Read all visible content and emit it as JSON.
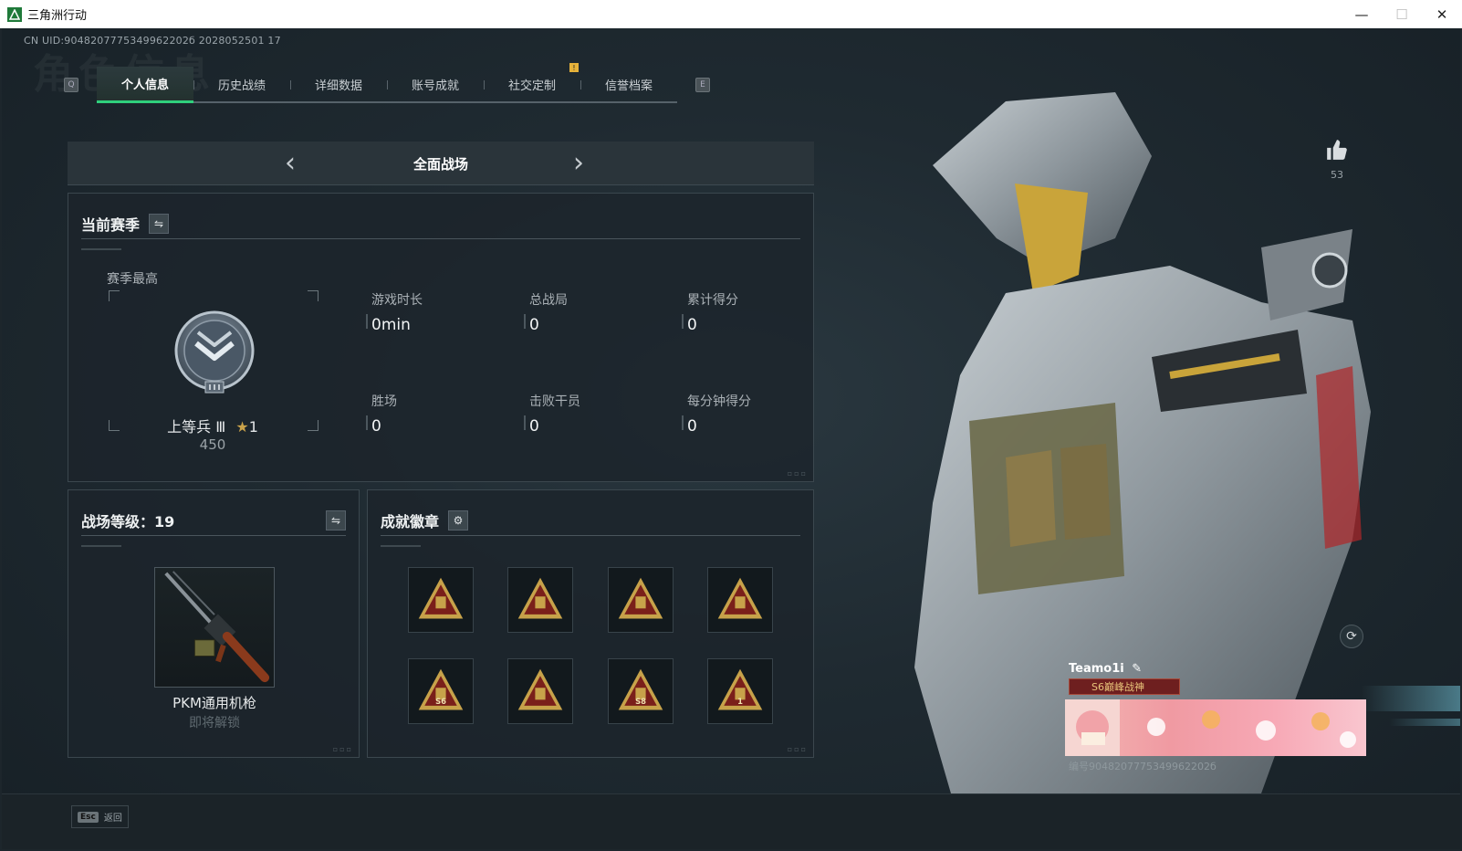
{
  "window": {
    "title": "三角洲行动",
    "minimize": "—",
    "maximize": "☐",
    "close": "✕"
  },
  "uid_line": "CN UID:9048207775349962202б 2028052501 17",
  "watermark": "角色信息",
  "tabs": {
    "left_key": "Q",
    "right_key": "E",
    "alert": "!",
    "items": [
      {
        "label": "个人信息",
        "active": true
      },
      {
        "label": "历史战绩",
        "active": false
      },
      {
        "label": "详细数据",
        "active": false
      },
      {
        "label": "账号成就",
        "active": false
      },
      {
        "label": "社交定制",
        "active": false
      },
      {
        "label": "信誉档案",
        "active": false
      }
    ]
  },
  "mode": {
    "title": "全面战场",
    "prev": "‹",
    "next": "›"
  },
  "season": {
    "heading": "当前赛季",
    "best_label": "赛季最高",
    "rank_name": "上等兵 Ⅲ",
    "rank_stars": "1",
    "rank_score": "450",
    "stats": [
      {
        "label": "游戏时长",
        "value": "0min"
      },
      {
        "label": "总战局",
        "value": "0"
      },
      {
        "label": "累计得分",
        "value": "0"
      },
      {
        "label": "胜场",
        "value": "0"
      },
      {
        "label": "击败干员",
        "value": "0"
      },
      {
        "label": "每分钟得分",
        "value": "0"
      }
    ]
  },
  "level": {
    "heading": "战场等级：19",
    "weapon_name": "PKM通用机枪",
    "weapon_status": "即将解锁"
  },
  "badges": {
    "heading": "成就徽章",
    "items": [
      {
        "icon": "badge-tank-icon",
        "text": ""
      },
      {
        "icon": "badge-helmet-icon",
        "text": ""
      },
      {
        "icon": "badge-rocket-icon",
        "text": ""
      },
      {
        "icon": "badge-eagle-icon",
        "text": ""
      },
      {
        "icon": "badge-s6-icon",
        "text": "S6"
      },
      {
        "icon": "badge-crate-icon",
        "text": ""
      },
      {
        "icon": "badge-s8-icon",
        "text": "S8"
      },
      {
        "icon": "badge-first-icon",
        "text": "1"
      }
    ]
  },
  "profile": {
    "likes": "53",
    "name": "Teamo1i",
    "title": "S6巅峰战神",
    "card_id": "编号9048207775349962202б"
  },
  "bottom": {
    "esc_key": "Esc",
    "esc_label": "返回"
  },
  "colors": {
    "accent_green": "#2fcf7c",
    "badge_gold": "#c7a24a",
    "badge_red": "#7a1f1a"
  }
}
